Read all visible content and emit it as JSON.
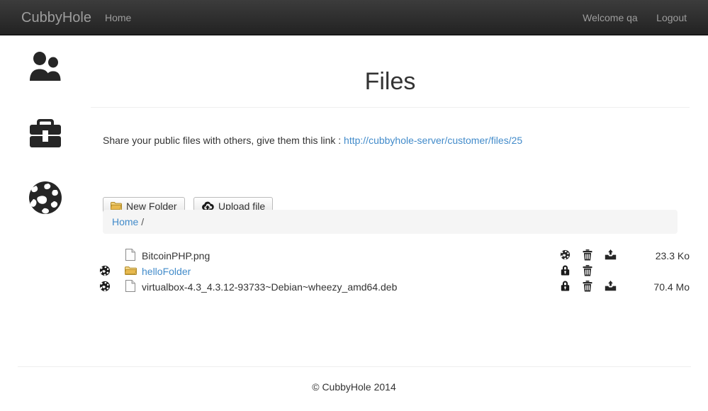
{
  "navbar": {
    "brand": "CubbyHole",
    "left_items": [
      {
        "label": "Home",
        "name": "nav-home"
      }
    ],
    "right_items": [
      {
        "label": "Welcome qa",
        "name": "nav-welcome-user"
      },
      {
        "label": "Logout",
        "name": "nav-logout"
      }
    ]
  },
  "sidebar": {
    "items": [
      {
        "icon": "users-icon",
        "name": "sidebar-item-users"
      },
      {
        "icon": "briefcase-icon",
        "name": "sidebar-item-briefcase"
      },
      {
        "icon": "globe-icon",
        "name": "sidebar-item-globe"
      }
    ]
  },
  "main": {
    "title": "Files",
    "share": {
      "text": "Share your public files with others, give them this link :",
      "link_label": "http://cubbyhole-server/customer/files/25"
    },
    "toolbar": {
      "new_folder_label": "New Folder",
      "upload_file_label": "Upload file"
    },
    "breadcrumb": {
      "home_label": "Home",
      "separator": "/"
    },
    "files": [
      {
        "share_state": "none",
        "type": "file",
        "name": "BitcoinPHP.png",
        "is_link": false,
        "actions": [
          "globe-icon",
          "trash-icon",
          "download-icon"
        ],
        "size": "23.3 Ko"
      },
      {
        "share_state": "public",
        "type": "folder",
        "name": "helloFolder",
        "is_link": true,
        "actions": [
          "lock-icon",
          "trash-icon"
        ],
        "size": ""
      },
      {
        "share_state": "public",
        "type": "file",
        "name": "virtualbox-4.3_4.3.12-93733~Debian~wheezy_amd64.deb",
        "is_link": false,
        "actions": [
          "lock-icon",
          "trash-icon",
          "download-icon"
        ],
        "size": "70.4 Mo"
      }
    ]
  },
  "footer": {
    "copyright": "© CubbyHole 2014"
  },
  "colors": {
    "navbar_top": "#3c3c3c",
    "navbar_bottom": "#222222",
    "nav_text": "#9d9d9d",
    "link": "#428bca",
    "breadcrumb_bg": "#f5f5f5",
    "folder_icon": "#e8b94e",
    "text": "#333333"
  }
}
